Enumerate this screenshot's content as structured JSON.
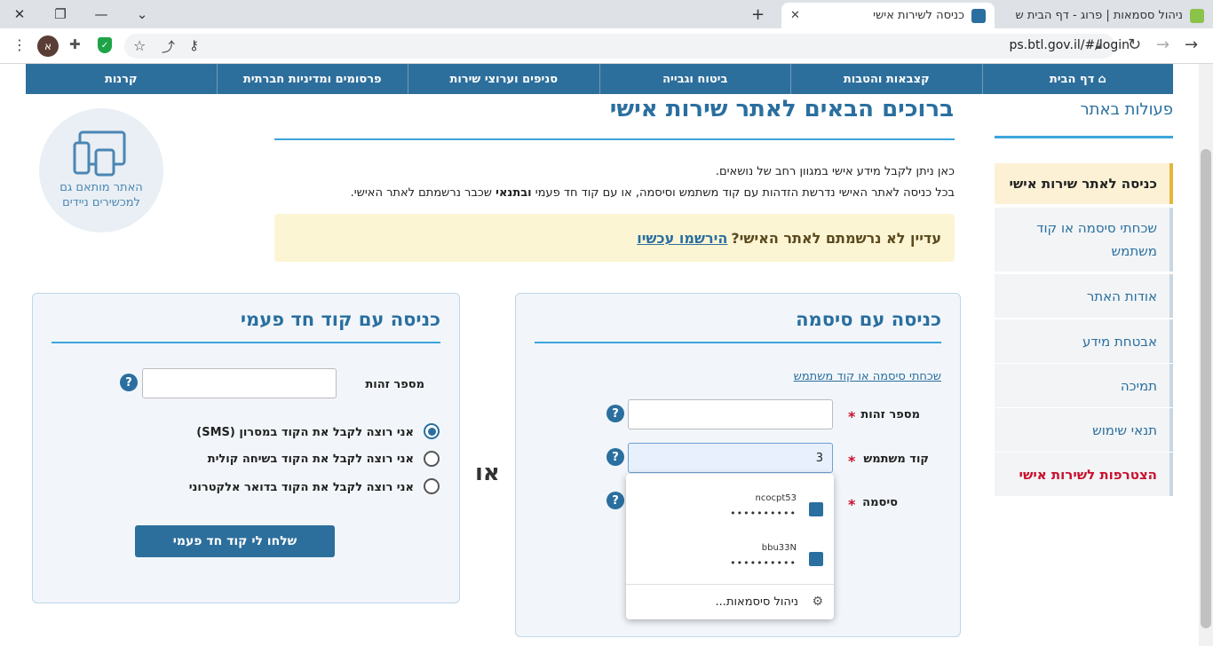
{
  "browser": {
    "tabs": [
      {
        "title": "ניהול ססמאות | פרוג - דף הבית ש",
        "active": false
      },
      {
        "title": "כניסה לשירות אישי",
        "active": true
      }
    ],
    "new_tab": "+",
    "url": "ps.btl.gov.il/#/login",
    "profile_initial": "א"
  },
  "nav": {
    "items": [
      "דף הבית",
      "קצבאות והטבות",
      "ביטוח וגבייה",
      "סניפים וערוצי שירות",
      "פרסומים ומדיניות חברתית",
      "קרנות"
    ]
  },
  "sidebar": {
    "title": "פעולות באתר",
    "items": [
      {
        "label": "כניסה לאתר שירות אישי",
        "state": "active"
      },
      {
        "label": "שכחתי סיסמה או קוד משתמש",
        "state": "normal"
      },
      {
        "label": "אודות האתר",
        "state": "normal"
      },
      {
        "label": "אבטחת מידע",
        "state": "normal"
      },
      {
        "label": "תמיכה",
        "state": "normal"
      },
      {
        "label": "תנאי שימוש",
        "state": "normal"
      },
      {
        "label": "הצטרפות לשירות אישי",
        "state": "red"
      }
    ]
  },
  "main": {
    "title": "ברוכים הבאים לאתר שירות אישי",
    "intro_line1": "כאן ניתן לקבל מידע אישי במגוון רחב של נושאים.",
    "intro_line2_a": "בכל כניסה לאתר האישי נדרשת הזדהות עם קוד משתמש וסיסמה, או עם קוד חד פעמי",
    "intro_line2_b": "ובתנאי",
    "intro_line2_c": "שכבר נרשמתם לאתר האישי.",
    "banner_question": "עדיין לא נרשמתם לאתר האישי?",
    "banner_link": "הירשמו עכשיו",
    "mobile_text": "האתר מותאם גם למכשירים ניידים"
  },
  "password_login": {
    "title": "כניסה עם סיסמה",
    "forgot_link": "שכחתי סיסמה או קוד משתמש",
    "id_label": "מספר זהות",
    "user_label": "קוד משתמש",
    "password_label": "סיסמה",
    "required_mark": "*",
    "help": "?",
    "id_value": "",
    "user_value": "3"
  },
  "or_label": "או",
  "otp_login": {
    "title": "כניסה עם קוד חד פעמי",
    "id_label": "מספר זהות",
    "help": "?",
    "id_value": "",
    "options": [
      {
        "label": "אני רוצה לקבל את הקוד במסרון (SMS)",
        "selected": true
      },
      {
        "label": "אני רוצה לקבל את הקוד בשיחה קולית",
        "selected": false
      },
      {
        "label": "אני רוצה לקבל את הקוד בדואר אלקטרוני",
        "selected": false
      }
    ],
    "send_button": "שלחו לי קוד חד פעמי"
  },
  "autocomplete": {
    "entries": [
      {
        "user": "ncocpt53",
        "password": "••••••••••"
      },
      {
        "user": "bbu33N",
        "password": "••••••••••"
      }
    ],
    "manage_label": "ניהול סיסמאות..."
  },
  "colors": {
    "primary": "#2d6f9c",
    "accent_line": "#3da5d9",
    "required": "#c8102e",
    "banner": "#fcf5d3"
  }
}
